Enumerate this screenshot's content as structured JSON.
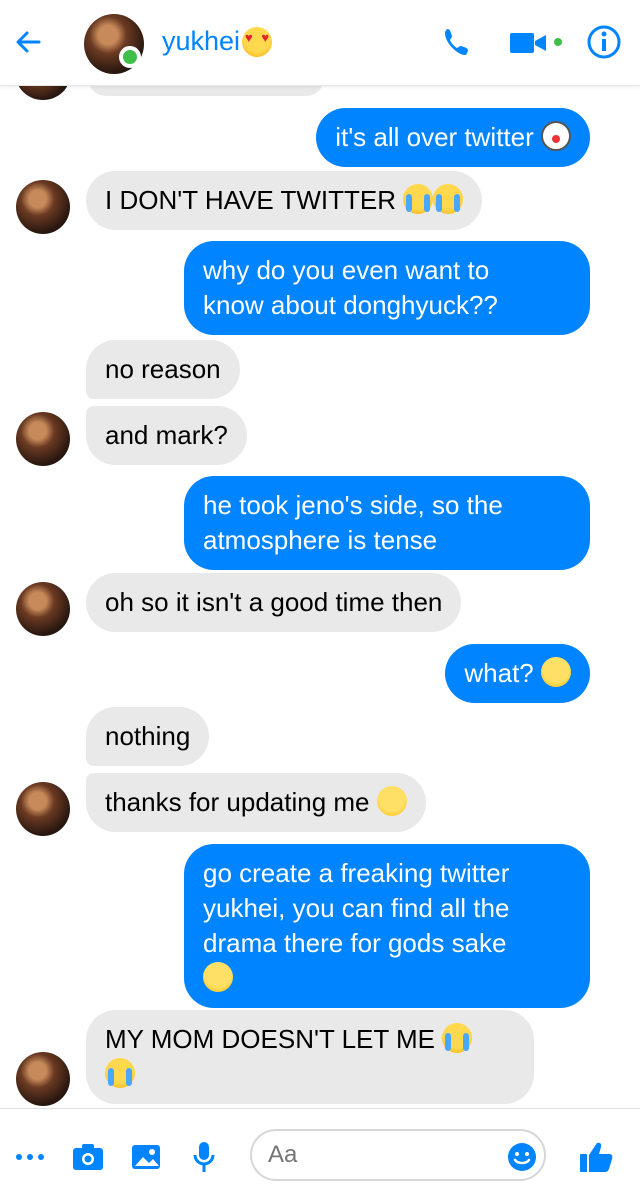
{
  "header": {
    "name": "yukhei",
    "name_emoji": "heart-eyes-emoji"
  },
  "messages": [
    {
      "from": "me",
      "text": "it's all over twitter",
      "emoji": "clown-emoji"
    },
    {
      "from": "them",
      "text": "I DON'T HAVE TWITTER",
      "emoji": "crying-emoji-x2"
    },
    {
      "from": "me",
      "text_lines": [
        "why do you even want to",
        "know about donghyuck??"
      ]
    },
    {
      "from": "them",
      "text": "no reason"
    },
    {
      "from": "them",
      "text": "and mark?"
    },
    {
      "from": "me",
      "text_lines": [
        "he took jeno's side, so the",
        "atmosphere is tense"
      ]
    },
    {
      "from": "them",
      "text": "oh so it isn't a good time then"
    },
    {
      "from": "me",
      "text": "what?",
      "emoji": "raised-eyebrow-emoji"
    },
    {
      "from": "them",
      "text": "nothing"
    },
    {
      "from": "them",
      "text": "thanks for updating me",
      "emoji": "kissing-emoji"
    },
    {
      "from": "me",
      "text_lines": [
        "go create a freaking twitter",
        "yukhei, you can find all the",
        "drama there for gods sake"
      ],
      "emoji": "eye-roll-emoji"
    },
    {
      "from": "them",
      "text": "MY MOM DOESN'T LET ME",
      "emoji": "crying-emoji-x2"
    }
  ],
  "composer": {
    "placeholder": "Aa"
  },
  "colors": {
    "accent": "#0084ff",
    "incoming_bubble": "#e9e9e9",
    "online": "#3fbf4a"
  }
}
